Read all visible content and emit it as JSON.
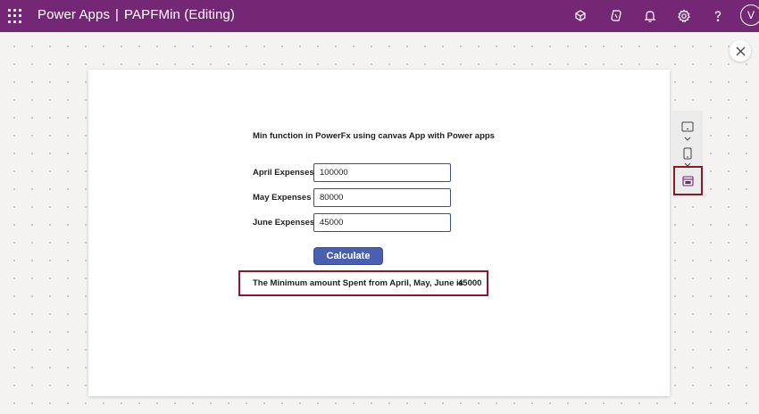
{
  "header": {
    "product": "Power Apps",
    "separator": "|",
    "app_name": "PAPFMin (Editing)",
    "avatar_initial": "V",
    "icons": [
      "waffle-icon",
      "environment-icon",
      "copilot-icon",
      "notifications-icon",
      "settings-icon",
      "help-icon"
    ]
  },
  "canvas": {
    "heading": "Min function in PowerFx using canvas App with Power apps",
    "rows": [
      {
        "label": "April Expenses",
        "value": "100000"
      },
      {
        "label": "May Expenses",
        "value": "80000"
      },
      {
        "label": "June Expenses",
        "value": "45000"
      }
    ],
    "button_label": "Calculate",
    "result_label": "The Minimum amount Spent from April, May, June is",
    "result_value": "45000"
  },
  "side_panel": {
    "icons": [
      "tablet-icon",
      "phone-icon",
      "calendar-icon"
    ]
  },
  "colors": {
    "header_bg": "#742774",
    "button_bg": "#4a5fb0",
    "highlight_border": "#8a1a28",
    "input_border": "#3b4f8a"
  }
}
